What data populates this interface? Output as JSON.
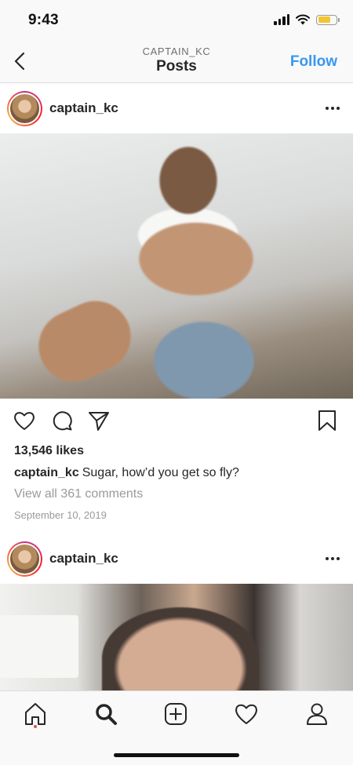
{
  "status_bar": {
    "time": "9:43"
  },
  "header": {
    "username": "CAPTAIN_KC",
    "title": "Posts",
    "follow_label": "Follow"
  },
  "posts": [
    {
      "username": "captain_kc",
      "likes": "13,546 likes",
      "caption_user": "captain_kc",
      "caption_text": "Sugar, how’d you get so fly?",
      "view_comments": "View all 361 comments",
      "date": "September 10, 2019"
    },
    {
      "username": "captain_kc"
    }
  ],
  "icons": {
    "back": "chevron-left-icon",
    "more": "more-horizontal-icon",
    "like": "heart-icon",
    "comment": "comment-icon",
    "share": "paper-plane-icon",
    "save": "bookmark-icon",
    "tabs": [
      "home-icon",
      "search-icon",
      "add-icon",
      "heart-icon",
      "profile-icon"
    ]
  },
  "colors": {
    "accent": "#3897f0",
    "notification_dot": "#ed4956",
    "battery": "#f2c531"
  }
}
